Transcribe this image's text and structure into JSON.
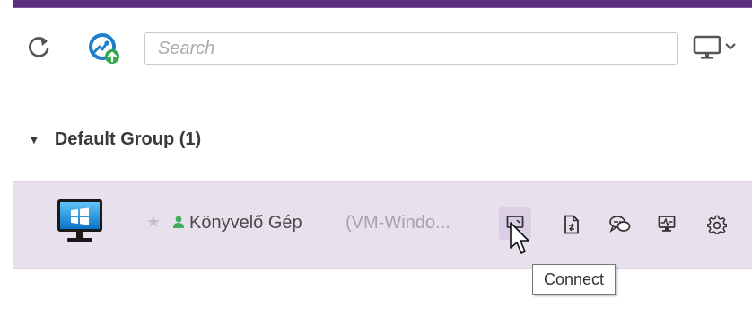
{
  "toolbar": {
    "search_placeholder": "Search",
    "refresh_icon": "refresh-icon",
    "remote_icon": "remote-access-icon",
    "monitor_icon": "monitor-icon"
  },
  "group": {
    "title": "Default Group (1)",
    "expanded": true
  },
  "device": {
    "name": "Könyvelő Gép",
    "subtitle": "(VM-Windo...",
    "os_icon": "windows-monitor-icon",
    "status": "online",
    "favorite": false,
    "actions": [
      {
        "name": "connect",
        "icon": "connect-icon"
      },
      {
        "name": "file-transfer",
        "icon": "file-transfer-icon"
      },
      {
        "name": "chat",
        "icon": "chat-icon"
      },
      {
        "name": "system-monitor",
        "icon": "performance-icon"
      },
      {
        "name": "settings",
        "icon": "gear-icon"
      }
    ]
  },
  "tooltip": {
    "text": "Connect"
  },
  "colors": {
    "accent_bar": "#5c2e7e",
    "row_highlight": "#e9e0ee",
    "online_green": "#3cb05a",
    "windows_blue": "#1a8ed8"
  }
}
